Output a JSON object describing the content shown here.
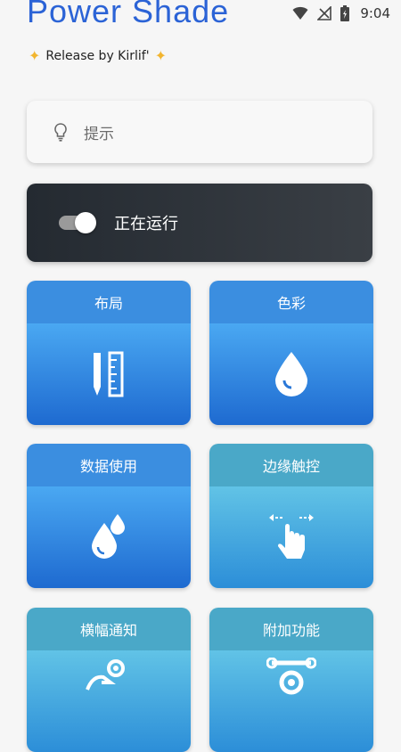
{
  "status_bar": {
    "time": "9:04",
    "icons": [
      "wifi-icon",
      "no-signal-icon",
      "battery-charging-icon"
    ]
  },
  "header": {
    "title": "Power Shade",
    "subtitle": "Release by Kirlif'"
  },
  "hint_card": {
    "label": "提示",
    "icon": "lightbulb-icon"
  },
  "service_card": {
    "label": "正在运行",
    "enabled": true
  },
  "tiles": [
    {
      "label": "布局",
      "icon": "pencil-ruler-icon"
    },
    {
      "label": "色彩",
      "icon": "water-drop-icon"
    },
    {
      "label": "数据使用",
      "icon": "double-drop-icon"
    },
    {
      "label": "边缘触控",
      "icon": "swipe-hand-icon"
    },
    {
      "label": "横幅通知",
      "icon": "hand-gear-icon"
    },
    {
      "label": "附加功能",
      "icon": "wrench-gear-icon"
    }
  ],
  "colors": {
    "title_blue": "#2b63d6",
    "tile_blue": "#2f86e0",
    "tile_teal": "#4aa8c8",
    "run_card": "#2a2f36"
  }
}
